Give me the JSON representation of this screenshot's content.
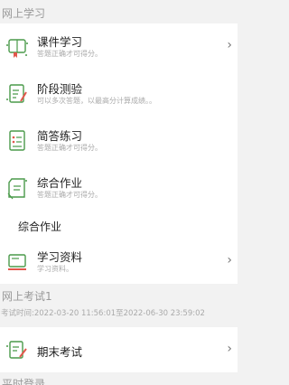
{
  "online_learning": {
    "header": "网上学习",
    "items": [
      {
        "title": "课件学习",
        "subtitle": "答题正确才可得分。",
        "icon": "courseware-icon",
        "chevron": "›"
      },
      {
        "title": "阶段测验",
        "subtitle": "可以多次答题，以最高分计算成绩。。",
        "icon": "quiz-icon",
        "chevron": ""
      },
      {
        "title": "简答练习",
        "subtitle": "答题正确才可得分。",
        "icon": "practice-icon",
        "chevron": ""
      },
      {
        "title": "综合作业",
        "subtitle": "答题正确才可得分。",
        "icon": "homework-icon",
        "chevron": ""
      }
    ],
    "group_label": "综合作业",
    "materials": {
      "title": "学习资料",
      "subtitle": "学习资料。",
      "icon": "materials-icon",
      "chevron": "›"
    }
  },
  "online_exam": {
    "header": "网上考试1",
    "time_range": "考试时间:2022-03-20 11:56:01至2022-06-30 23:59:02",
    "items": [
      {
        "title": "期末考试",
        "icon": "exam-icon",
        "chevron": "›"
      }
    ]
  },
  "next_section": {
    "header": "平时登录"
  },
  "colors": {
    "icon_green": "#4a9a4a",
    "icon_red": "#e2574c",
    "header_text": "#999999",
    "background": "#f2f2f2"
  }
}
